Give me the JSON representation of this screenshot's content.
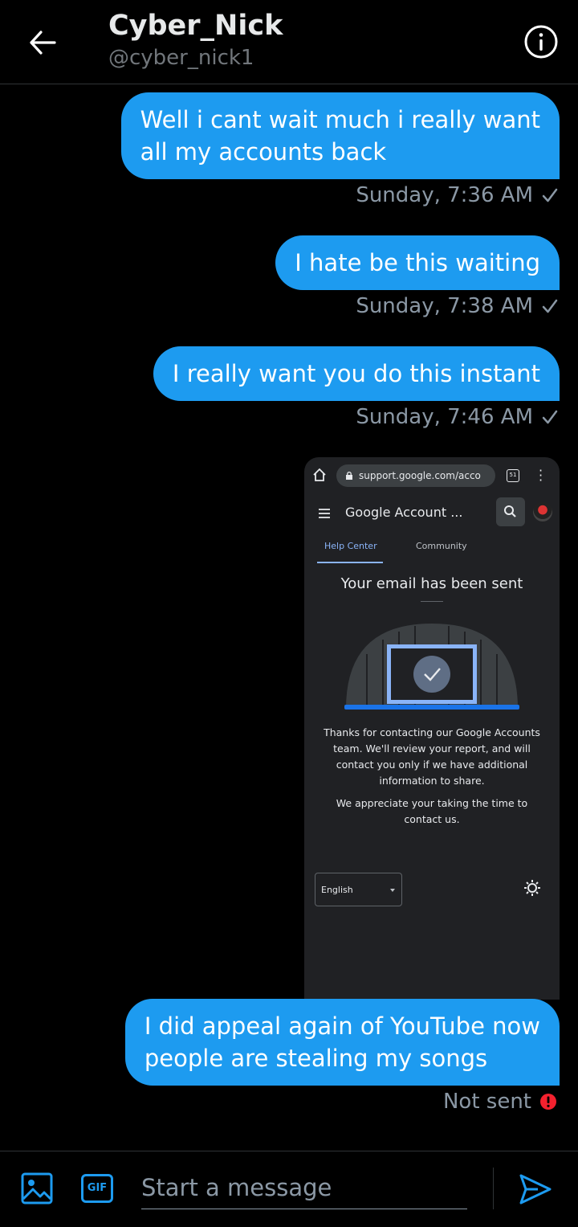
{
  "header": {
    "name": "Cyber_Nick",
    "handle": "@cyber_nick1"
  },
  "messages": [
    {
      "text_line1": "Well i cant wait much i really want",
      "text_line2": "all my accounts back",
      "time": "Sunday, 7:36 AM"
    },
    {
      "text": "I hate be this waiting",
      "time": "Sunday, 7:38 AM"
    },
    {
      "text": "I really want you do this instant",
      "time": "Sunday, 7:46 AM"
    },
    {
      "text_line1": "I did appeal again of YouTube now",
      "text_line2": "people are stealing my songs",
      "status": "Not sent"
    }
  ],
  "screenshot": {
    "url": "support.google.com/acco",
    "tabs_count": "51",
    "page_title": "Google Account ...",
    "tab_help": "Help Center",
    "tab_community": "Community",
    "heading": "Your email has been sent",
    "para1": "Thanks for contacting our Google Accounts team. We'll review your report, and will contact you only if we have additional information to share.",
    "para2": "We appreciate your taking the time to contact us.",
    "language": "English"
  },
  "compose": {
    "placeholder": "Start a message",
    "gif_label": "GIF"
  },
  "colors": {
    "accent": "#1d9bf0",
    "error": "#f4212e"
  }
}
